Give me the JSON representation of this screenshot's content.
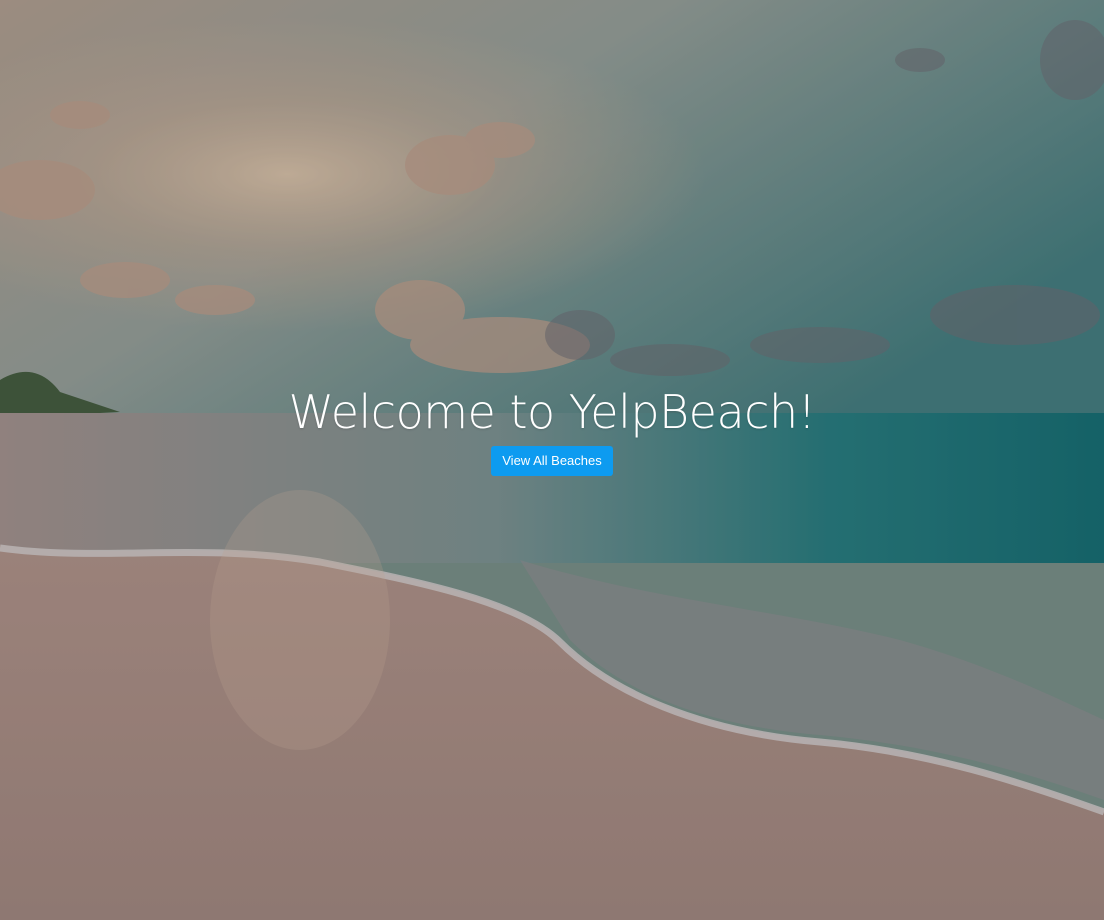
{
  "hero": {
    "title": "Welcome to YelpBeach!",
    "button_label": "View All Beaches",
    "accent_color": "#0d9bf0"
  }
}
